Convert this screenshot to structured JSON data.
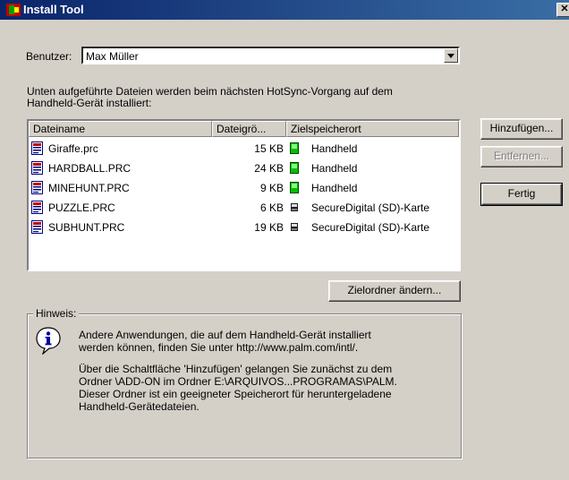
{
  "window": {
    "title": "Install Tool",
    "close_glyph": "✕"
  },
  "user": {
    "label": "Benutzer:",
    "value": "Max Müller"
  },
  "intro_text": {
    "line1": "Unten aufgeführte Dateien werden beim nächsten HotSync-Vorgang auf dem",
    "line2": "Handheld-Gerät installiert:"
  },
  "columns": [
    "Dateiname",
    "Dateigrö...",
    "Zielspeicherort"
  ],
  "files": [
    {
      "name": "Giraffe.prc",
      "size": "15 KB",
      "dest": "Handheld",
      "dest_icon": "handheld-icon"
    },
    {
      "name": "HARDBALL.PRC",
      "size": "24 KB",
      "dest": "Handheld",
      "dest_icon": "handheld-icon"
    },
    {
      "name": "MINEHUNT.PRC",
      "size": "9 KB",
      "dest": "Handheld",
      "dest_icon": "handheld-icon"
    },
    {
      "name": "PUZZLE.PRC",
      "size": "6 KB",
      "dest": "SecureDigital (SD)-Karte",
      "dest_icon": "sd-card-icon"
    },
    {
      "name": "SUBHUNT.PRC",
      "size": "19 KB",
      "dest": "SecureDigital (SD)-Karte",
      "dest_icon": "sd-card-icon"
    }
  ],
  "buttons": {
    "add": "Hinzufügen...",
    "remove": "Entfernen...",
    "done": "Fertig",
    "change_folder": "Zielordner ändern..."
  },
  "hint": {
    "title": "Hinweis:",
    "p1_line1": "Andere Anwendungen, die auf dem Handheld-Gerät installiert",
    "p1_line2": "werden können, finden Sie unter http://www.palm.com/intl/.",
    "p2_line1": "Über die Schaltfläche 'Hinzufügen' gelangen Sie zunächst zu dem",
    "p2_line2": "Ordner \\ADD-ON im Ordner E:\\ARQUIVOS...PROGRAMAS\\PALM.",
    "p2_line3": "Dieser Ordner ist ein geeigneter Speicherort für heruntergeladene",
    "p2_line4": "Handheld-Gerätedateien."
  },
  "colors": {
    "titlebar_start": "#0a246a",
    "titlebar_end": "#3a6ea5",
    "face": "#d4d0c8",
    "handheld_green": "#00c000"
  }
}
